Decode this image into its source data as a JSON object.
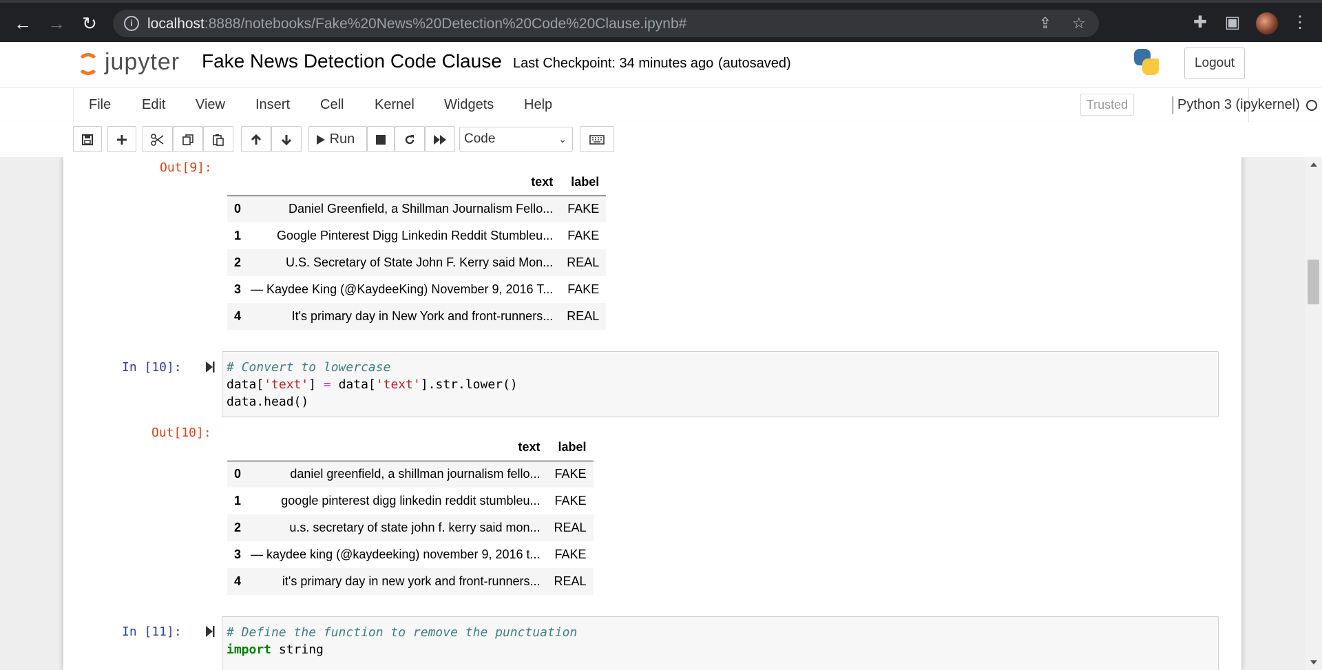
{
  "browser": {
    "url_host": "localhost",
    "url_rest": ":8888/notebooks/Fake%20News%20Detection%20Code%20Clause.ipynb#"
  },
  "header": {
    "logo_text": "jupyter",
    "notebook_title": "Fake News Detection Code Clause",
    "checkpoint": "Last Checkpoint: 34 minutes ago",
    "autosave": "(autosaved)",
    "logout_label": "Logout"
  },
  "menu": {
    "items": [
      "File",
      "Edit",
      "View",
      "Insert",
      "Cell",
      "Kernel",
      "Widgets",
      "Help"
    ],
    "trusted_label": "Trusted",
    "kernel_name": "Python 3 (ipykernel)"
  },
  "toolbar": {
    "run_label": "Run",
    "cell_type": "Code"
  },
  "cells": {
    "out9": {
      "prompt": "Out[9]:",
      "columns": [
        "",
        "text",
        "label"
      ],
      "rows": [
        {
          "index": "0",
          "text": "Daniel Greenfield, a Shillman Journalism Fello...",
          "label": "FAKE"
        },
        {
          "index": "1",
          "text": "Google Pinterest Digg Linkedin Reddit Stumbleu...",
          "label": "FAKE"
        },
        {
          "index": "2",
          "text": "U.S. Secretary of State John F. Kerry said Mon...",
          "label": "REAL"
        },
        {
          "index": "3",
          "text": "— Kaydee King (@KaydeeKing) November 9, 2016 T...",
          "label": "FAKE"
        },
        {
          "index": "4",
          "text": "It's primary day in New York and front-runners...",
          "label": "REAL"
        }
      ]
    },
    "in10": {
      "prompt": "In [10]:",
      "code_comment": "# Convert to lowercase",
      "line2_a": "data[",
      "line2_s1": "'text'",
      "line2_b": "] ",
      "line2_op": "=",
      "line2_c": " data[",
      "line2_s2": "'text'",
      "line2_d": "].str.lower()",
      "line3": "data.head()"
    },
    "out10": {
      "prompt": "Out[10]:",
      "columns": [
        "",
        "text",
        "label"
      ],
      "rows": [
        {
          "index": "0",
          "text": "daniel greenfield, a shillman journalism fello...",
          "label": "FAKE"
        },
        {
          "index": "1",
          "text": "google pinterest digg linkedin reddit stumbleu...",
          "label": "FAKE"
        },
        {
          "index": "2",
          "text": "u.s. secretary of state john f. kerry said mon...",
          "label": "REAL"
        },
        {
          "index": "3",
          "text": "— kaydee king (@kaydeeking) november 9, 2016 t...",
          "label": "FAKE"
        },
        {
          "index": "4",
          "text": "it's primary day in new york and front-runners...",
          "label": "REAL"
        }
      ]
    },
    "in11": {
      "prompt": "In [11]:",
      "code_comment": "# Define the function to remove the punctuation",
      "kw": "import",
      "rest": " string"
    }
  }
}
